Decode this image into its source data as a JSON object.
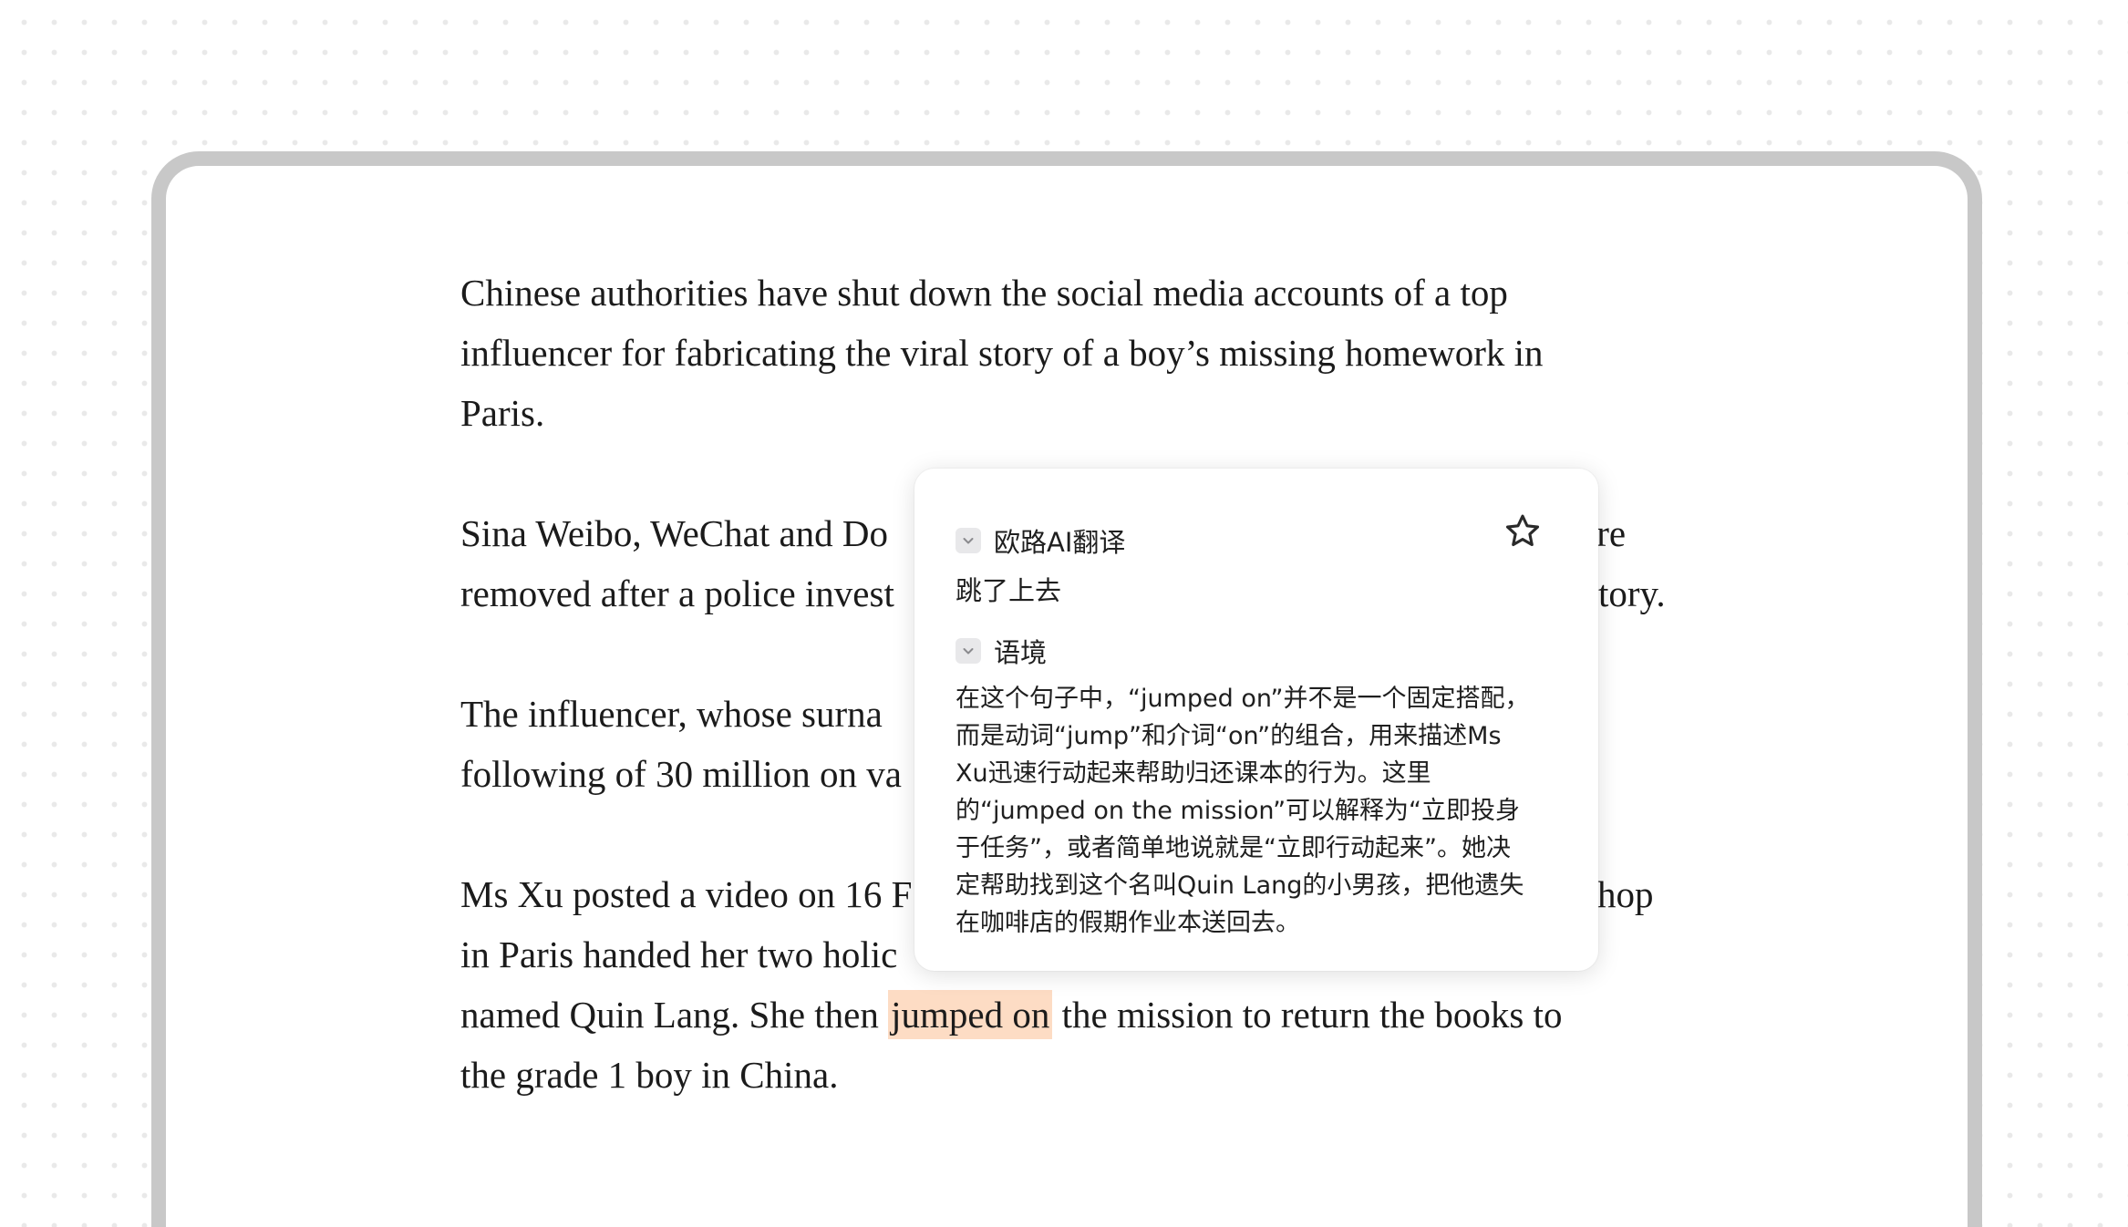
{
  "article": {
    "p1": [
      "Chinese authorities have shut down the social media accounts of a top",
      "influencer for fabricating the viral story of a boy’s missing homework in",
      "Paris."
    ],
    "p2": [
      "Sina Weibo, WeChat and Do",
      "removed after a police invest"
    ],
    "p2_tail": [
      "ere",
      "tory."
    ],
    "p3": [
      "The influencer, whose surna",
      "following of 30 million on va"
    ],
    "p4": [
      "Ms Xu posted a video on 16 F",
      "in Paris handed her two holic"
    ],
    "p4_tail": [
      "hop"
    ],
    "p4_line3_before": "named Quin Lang. She then ",
    "p4_highlight": "jumped on",
    "p4_line3_after": " the mission to return the books to",
    "p4_line4": "the grade 1 boy in China."
  },
  "popup": {
    "translation_header": "欧路AI翻译",
    "translation_text": "跳了上去",
    "context_header": "语境",
    "context_lines": [
      "在这个句子中，“jumped on”并不是一个固定搭配，",
      "而是动词“jump”和介词“on”的组合，用来描述Ms",
      "Xu迅速行动起来帮助归还课本的行为。这里",
      "的“jumped on the mission”可以解释为“立即投身",
      "于任务”，或者简单地说就是“立即行动起来”。她决",
      "定帮助找到这个名叫Quin Lang的小男孩，把他遗失",
      "在咖啡店的假期作业本送回去。"
    ],
    "star_icon": "star-outline-icon",
    "chevron_icon": "chevron-down-icon"
  },
  "colors": {
    "highlight": "#fddcc4",
    "frame_border": "#c8c8c8",
    "text": "#1b1b1b"
  }
}
